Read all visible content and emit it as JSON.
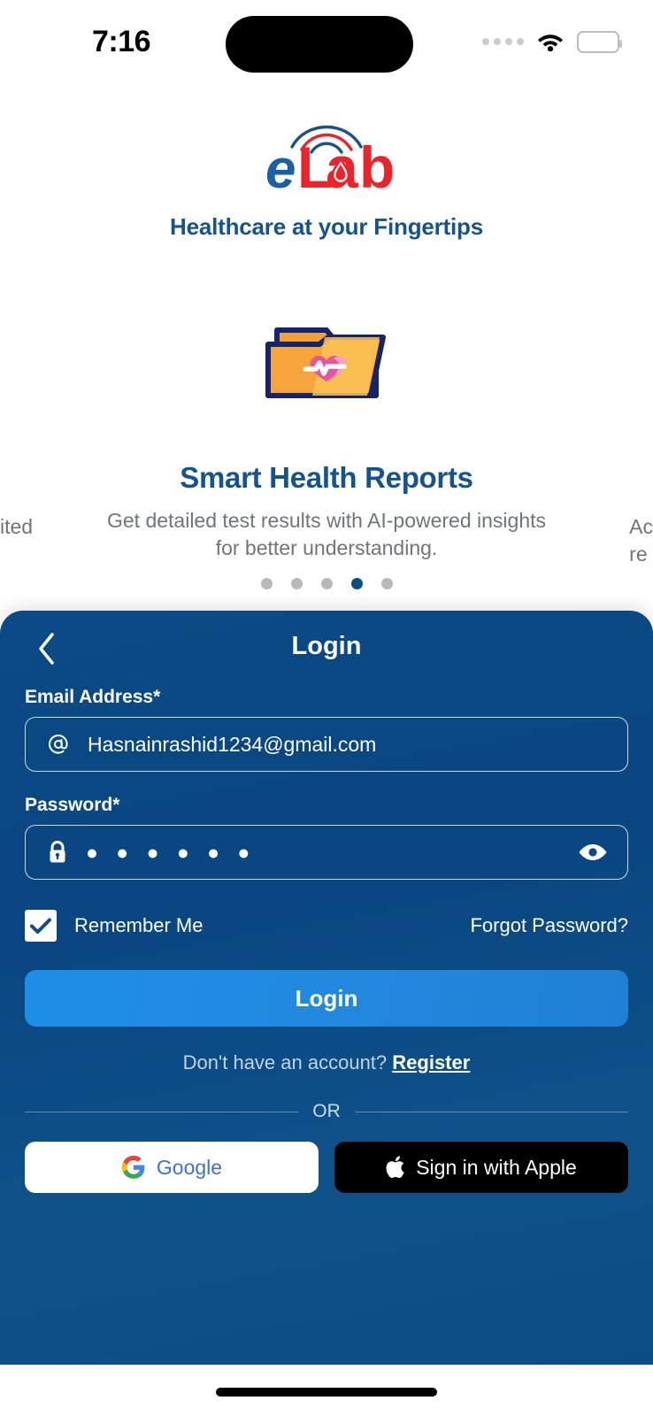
{
  "status_bar": {
    "time": "7:16",
    "cellular_icon": "cellular-dots-icon",
    "wifi_icon": "wifi-icon",
    "battery_icon": "battery-icon"
  },
  "brand": {
    "logo_icon": "elab-logo",
    "logo_text_primary": "e",
    "logo_text_secondary": "Lab",
    "tagline": "Healthcare at your Fingertips",
    "logo_blue": "#14538f",
    "logo_red": "#e8252b"
  },
  "carousel": {
    "illustration_icon": "health-folder-icon",
    "title": "Smart Health Reports",
    "description": "Get detailed test results with AI-powered insights for better understanding.",
    "edge_left_text": "ited",
    "edge_right_line1": "Ac",
    "edge_right_line2": "re",
    "dots_total": 5,
    "active_dot": 4,
    "active_dot_color": "#0f4c8a",
    "inactive_dot_color": "#b6b9bd"
  },
  "login": {
    "back_icon": "chevron-left-icon",
    "title": "Login",
    "email": {
      "label": "Email Address*",
      "icon": "at-sign-icon",
      "value": "Hasnainrashid1234@gmail.com",
      "placeholder": "Email Address"
    },
    "password": {
      "label": "Password*",
      "icon": "lock-icon",
      "value": "● ● ● ● ● ●",
      "placeholder": "Password",
      "toggle_icon": "eye-icon"
    },
    "remember_me": {
      "label": "Remember Me",
      "checked": true,
      "check_icon": "checkmark-icon"
    },
    "forgot_password": "Forgot Password?",
    "submit_label": "Login",
    "register_prompt": "Don't have an account? ",
    "register_link": "Register",
    "divider_text": "OR",
    "google_label": "Google",
    "google_icon": "google-g-icon",
    "apple_label": "Sign in with Apple",
    "apple_icon": "apple-logo-icon",
    "panel_color": "#0b4a86",
    "button_color": "#1e8fe8"
  }
}
